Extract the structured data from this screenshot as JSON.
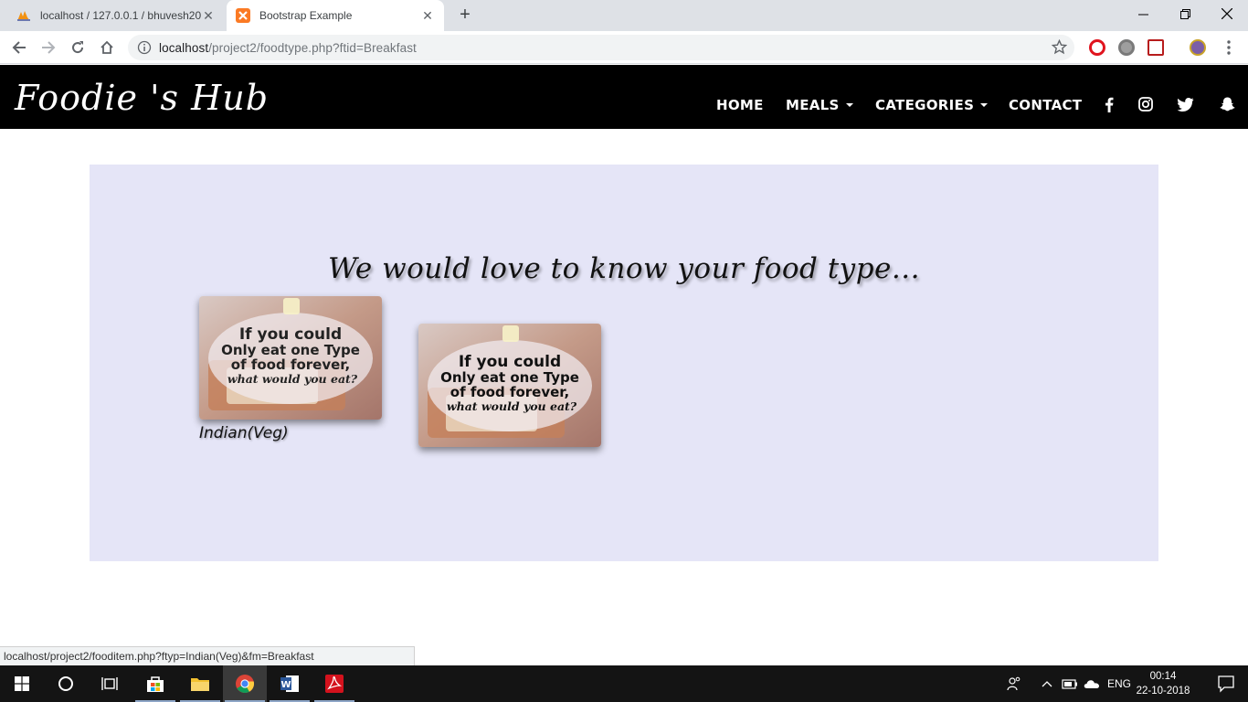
{
  "browser": {
    "tabs": [
      {
        "title": "localhost / 127.0.0.1 / bhuvesh20"
      },
      {
        "title": "Bootstrap Example"
      }
    ],
    "url_host": "localhost",
    "url_path": "/project2/foodtype.php?ftid=Breakfast",
    "status_url": "localhost/project2/fooditem.php?ftyp=Indian(Veg)&fm=Breakfast"
  },
  "site": {
    "brand": "Foodie 's Hub",
    "nav": {
      "home": "HOME",
      "meals": "MEALS",
      "categories": "CATEGORIES",
      "contact": "CONTACT"
    },
    "social_icons": [
      "facebook-icon",
      "instagram-icon",
      "twitter-icon",
      "snapchat-icon"
    ]
  },
  "main": {
    "tagline": "We would love to know your food type...",
    "cards": [
      {
        "label": "Indian(Veg)",
        "image_lines": [
          "If you could",
          "Only eat one Type",
          "of food forever,",
          "what would you eat?"
        ]
      },
      {
        "label": "",
        "image_lines": [
          "If you could",
          "Only eat one Type",
          "of food forever,",
          "what would you eat?"
        ]
      }
    ]
  },
  "taskbar": {
    "lang": "ENG",
    "time": "00:14",
    "date": "22-10-2018"
  },
  "colors": {
    "nav_bg": "#000000",
    "panel_bg": "#e5e5f7"
  }
}
